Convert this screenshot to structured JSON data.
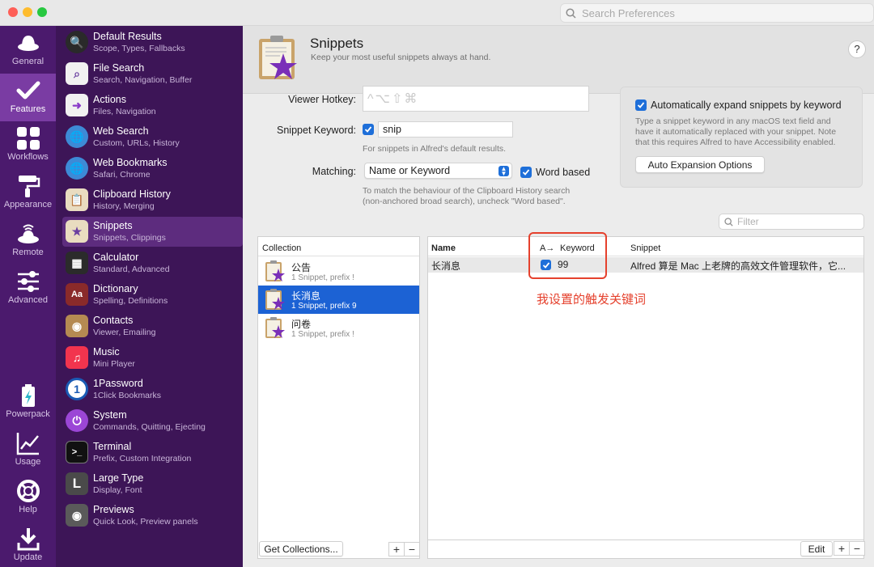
{
  "window": {
    "search_placeholder": "Search Preferences"
  },
  "rail": {
    "items": [
      {
        "label": "General"
      },
      {
        "label": "Features"
      },
      {
        "label": "Workflows"
      },
      {
        "label": "Appearance"
      },
      {
        "label": "Remote"
      },
      {
        "label": "Advanced"
      },
      {
        "label": "Powerpack"
      },
      {
        "label": "Usage"
      },
      {
        "label": "Help"
      },
      {
        "label": "Update"
      }
    ]
  },
  "features": {
    "items": [
      {
        "title": "Default Results",
        "subtitle": "Scope, Types, Fallbacks"
      },
      {
        "title": "File Search",
        "subtitle": "Search, Navigation, Buffer"
      },
      {
        "title": "Actions",
        "subtitle": "Files, Navigation"
      },
      {
        "title": "Web Search",
        "subtitle": "Custom, URLs, History"
      },
      {
        "title": "Web Bookmarks",
        "subtitle": "Safari, Chrome"
      },
      {
        "title": "Clipboard History",
        "subtitle": "History, Merging"
      },
      {
        "title": "Snippets",
        "subtitle": "Snippets, Clippings"
      },
      {
        "title": "Calculator",
        "subtitle": "Standard, Advanced"
      },
      {
        "title": "Dictionary",
        "subtitle": "Spelling, Definitions"
      },
      {
        "title": "Contacts",
        "subtitle": "Viewer, Emailing"
      },
      {
        "title": "Music",
        "subtitle": "Mini Player"
      },
      {
        "title": "1Password",
        "subtitle": "1Click Bookmarks"
      },
      {
        "title": "System",
        "subtitle": "Commands, Quitting, Ejecting"
      },
      {
        "title": "Terminal",
        "subtitle": "Prefix, Custom Integration"
      },
      {
        "title": "Large Type",
        "subtitle": "Display, Font"
      },
      {
        "title": "Previews",
        "subtitle": "Quick Look, Preview panels"
      }
    ]
  },
  "header": {
    "title": "Snippets",
    "subtitle": "Keep your most useful snippets always at hand.",
    "help": "?"
  },
  "settings": {
    "viewer_hotkey_label": "Viewer Hotkey:",
    "viewer_hotkey_value": "^⌥⇧⌘",
    "snippet_keyword_label": "Snippet Keyword:",
    "snippet_keyword_value": "snip",
    "snippet_keyword_note": "For snippets in Alfred's default results.",
    "matching_label": "Matching:",
    "matching_value": "Name or Keyword",
    "word_based_label": "Word based",
    "matching_note_1": "To match the behaviour of the Clipboard History search",
    "matching_note_2": "(non-anchored broad search), uncheck \"Word based\"."
  },
  "auto_expand": {
    "label": "Automatically expand snippets by keyword",
    "note_1": "Type a snippet keyword in any macOS text field and",
    "note_2": "have it automatically replaced with your snippet. Note",
    "note_3": "that this requires Alfred to have Accessibility enabled.",
    "button": "Auto Expansion Options"
  },
  "filter_placeholder": "Filter",
  "collections": {
    "header": "Collection",
    "items": [
      {
        "name": "公告",
        "detail": "1 Snippet, prefix !"
      },
      {
        "name": "长消息",
        "detail": "1 Snippet, prefix 9"
      },
      {
        "name": "问卷",
        "detail": "1 Snippet, prefix !"
      }
    ],
    "get_button": "Get Collections...",
    "plus": "+",
    "minus": "−"
  },
  "snippets": {
    "col_name": "Name",
    "col_auto": "A→",
    "col_keyword": "Keyword",
    "col_snippet": "Snippet",
    "rows": [
      {
        "name": "长消息",
        "keyword": "99",
        "snippet": "Alfred 算是 Mac 上老牌的高效文件管理软件，它..."
      }
    ],
    "edit_button": "Edit",
    "plus": "+",
    "minus": "−"
  },
  "annotation": "我设置的触发关键词",
  "colors": {
    "rail_bg": "#4b1a6d",
    "list_bg": "#3d1557",
    "selection": "#1c62d4",
    "annotation": "#e5412d"
  }
}
